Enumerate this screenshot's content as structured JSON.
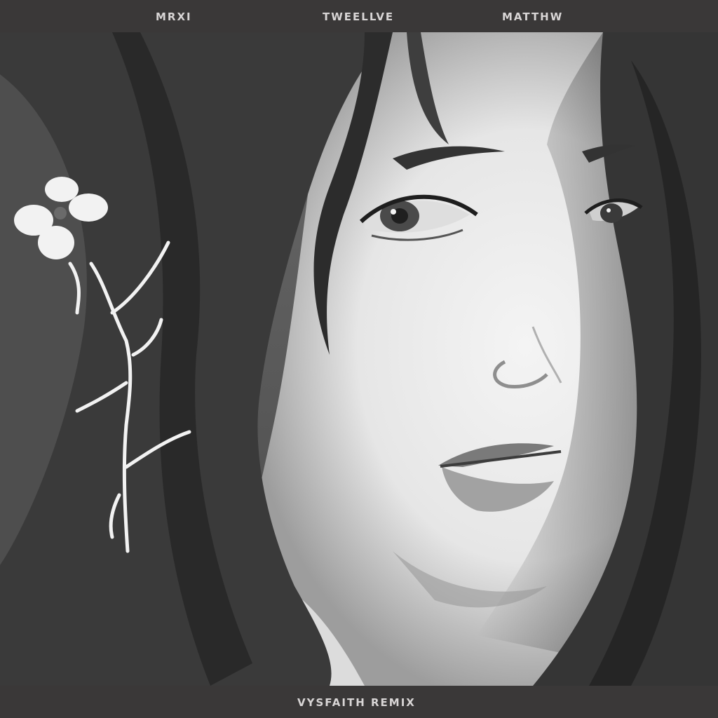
{
  "header": {
    "artists": [
      "MRXI",
      "TWEELLVE",
      "MATTHW"
    ]
  },
  "footer": {
    "subtitle": "VYSFAITH REMIX"
  },
  "artwork": {
    "description_icon": "portrait-illustration",
    "palette": {
      "bar": "#3a3838",
      "text": "#d9d6d6",
      "skin": "#eeeeee",
      "hair": "#2e2e2e"
    }
  }
}
